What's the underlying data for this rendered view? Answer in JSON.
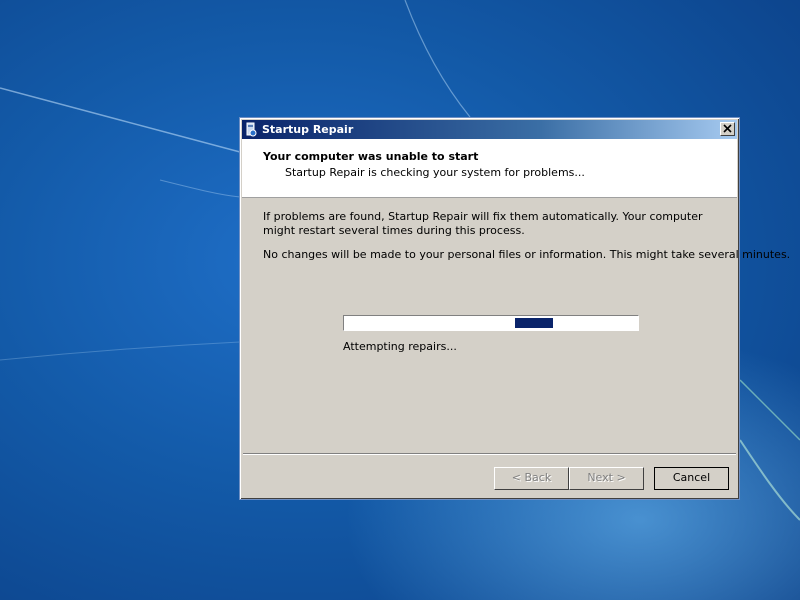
{
  "window": {
    "title": "Startup Repair",
    "icon": "startup-repair-icon",
    "close_icon": "close-icon"
  },
  "header": {
    "title": "Your computer was unable to start",
    "subtitle": "Startup Repair is checking your system for problems..."
  },
  "body": {
    "paragraph1": "If problems are found, Startup Repair will fix them automatically. Your computer might restart several times during this process.",
    "paragraph2": "No changes will be made to your personal files or information. This might take several minutes."
  },
  "progress": {
    "status": "Attempting repairs...",
    "indicator_start": 0.58,
    "indicator_end": 0.71,
    "style": "marquee"
  },
  "buttons": {
    "back": "< Back",
    "next": "Next >",
    "cancel": "Cancel"
  },
  "colors": {
    "desktop_blue": "#135aa8",
    "dialog_face": "#d4d0c8",
    "titlebar_start": "#0a246a",
    "progress_fill": "#0a246a"
  }
}
